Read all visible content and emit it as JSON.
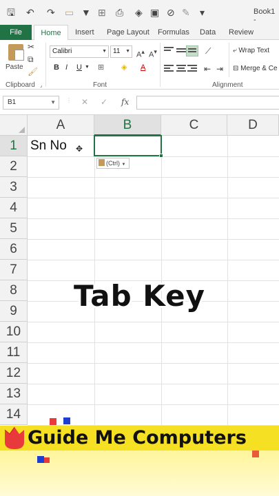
{
  "window": {
    "title": "Book1 -"
  },
  "quick_access": {
    "icons": [
      "save-icon",
      "undo-icon",
      "redo-icon",
      "open-icon",
      "filter-icon",
      "borders-icon",
      "print-preview-icon",
      "fill-color-icon",
      "paste-special-icon",
      "clear-icon"
    ]
  },
  "ribbon_tabs": [
    "File",
    "Home",
    "Insert",
    "Page Layout",
    "Formulas",
    "Data",
    "Review"
  ],
  "ribbon": {
    "clipboard": {
      "paste_label": "Paste",
      "group_label": "Clipboard"
    },
    "font": {
      "font_name": "Calibri",
      "font_size": "11",
      "group_label": "Font",
      "bold": "B",
      "italic": "I",
      "underline": "U"
    },
    "alignment": {
      "wrap_text": "Wrap Text",
      "merge": "Merge & Ce",
      "group_label": "Alignment"
    }
  },
  "formula_bar": {
    "name_box": "B1",
    "cancel": "✕",
    "enter": "✓",
    "fx": "fx",
    "value": ""
  },
  "sheet": {
    "columns": [
      "A",
      "B",
      "C",
      "D"
    ],
    "rows": [
      "1",
      "2",
      "3",
      "4",
      "5",
      "6",
      "7",
      "8",
      "9",
      "10",
      "11",
      "12",
      "13",
      "14"
    ],
    "cells": {
      "A1": "Sn No"
    },
    "active_cell": "B1",
    "paste_options_label": "(Ctrl)"
  },
  "overlay": {
    "caption": "Tab Key"
  },
  "brand": {
    "name": "Guide Me Computers",
    "colors": {
      "banner": "#f5e023",
      "accent_red": "#e83a3a",
      "accent_blue": "#1c3fd0",
      "excel_green": "#217346"
    }
  }
}
